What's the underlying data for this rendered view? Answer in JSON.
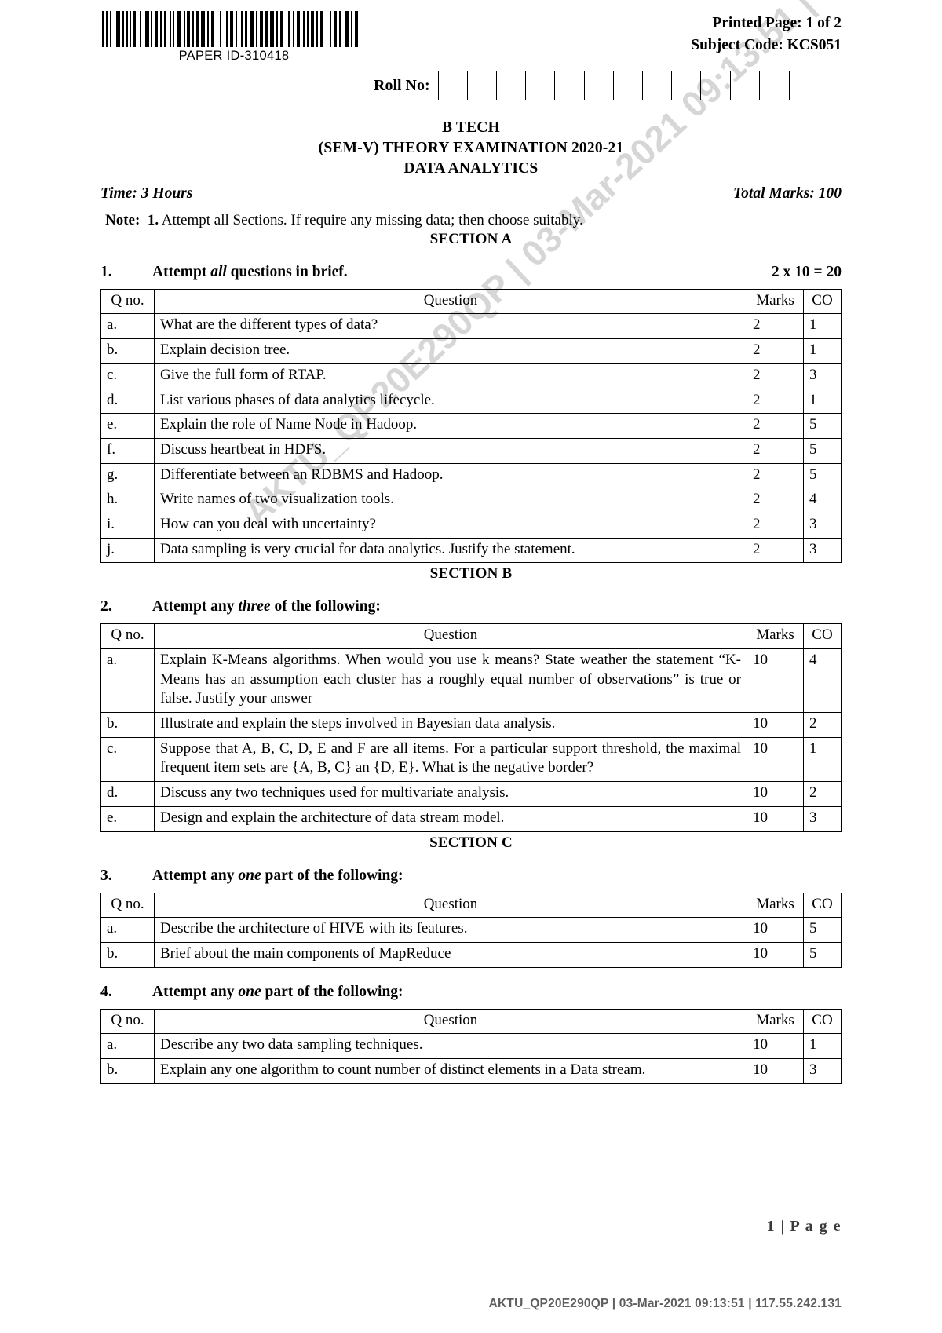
{
  "header": {
    "paper_id": "PAPER ID-310418",
    "printed_page": "Printed Page: 1 of 2",
    "subject_code": "Subject Code: KCS051",
    "roll_label": "Roll No:",
    "roll_box_count": 12
  },
  "titles": {
    "line1": "B TECH",
    "line2": "(SEM-V) THEORY EXAMINATION 2020-21",
    "line3": "DATA ANALYTICS",
    "time": "Time: 3 Hours",
    "total_marks": "Total Marks: 100",
    "note_label": "Note:",
    "note_number": "1.",
    "note_text": "Attempt all Sections. If require any missing data; then choose suitably."
  },
  "sections": {
    "a_heading": "SECTION A",
    "b_heading": "SECTION B",
    "c_heading": "SECTION C"
  },
  "columns": {
    "qno": "Q no.",
    "question": "Question",
    "marks": "Marks",
    "co": "CO"
  },
  "q1": {
    "number": "1.",
    "prompt_pre": "Attempt ",
    "prompt_em": "all",
    "prompt_post": " questions in brief.",
    "marks_formula": "2 x 10 = 20",
    "rows": [
      {
        "qno": "a.",
        "question": "What are the different types of data?",
        "marks": "2",
        "co": "1"
      },
      {
        "qno": "b.",
        "question": "Explain decision tree.",
        "marks": "2",
        "co": "1"
      },
      {
        "qno": "c.",
        "question": "Give the full form of RTAP.",
        "marks": "2",
        "co": "3"
      },
      {
        "qno": "d.",
        "question": "List various phases of data analytics lifecycle.",
        "marks": "2",
        "co": "1"
      },
      {
        "qno": "e.",
        "question": "Explain the role of Name Node in Hadoop.",
        "marks": "2",
        "co": "5"
      },
      {
        "qno": "f.",
        "question": "Discuss heartbeat in HDFS.",
        "marks": "2",
        "co": "5"
      },
      {
        "qno": "g.",
        "question": "Differentiate between an RDBMS and Hadoop.",
        "marks": "2",
        "co": "5"
      },
      {
        "qno": "h.",
        "question": "Write names of two visualization tools.",
        "marks": "2",
        "co": "4"
      },
      {
        "qno": "i.",
        "question": "How can you deal with uncertainty?",
        "marks": "2",
        "co": "3"
      },
      {
        "qno": "j.",
        "question": "Data sampling is very crucial for data analytics. Justify the statement.",
        "marks": "2",
        "co": "3"
      }
    ]
  },
  "q2": {
    "number": "2.",
    "prompt_pre": "Attempt any ",
    "prompt_em": "three",
    "prompt_post": " of the following:",
    "rows": [
      {
        "qno": "a.",
        "question": "Explain K-Means algorithms. When would you use k means? State weather the statement “K-Means has an assumption each cluster has a roughly equal number of observations” is true or false. Justify your answer",
        "marks": "10",
        "co": "4"
      },
      {
        "qno": "b.",
        "question": "Illustrate and explain the steps involved in Bayesian data analysis.",
        "marks": "10",
        "co": "2"
      },
      {
        "qno": "c.",
        "question": "Suppose that A, B, C, D, E and F are all items. For a particular support threshold, the maximal frequent item sets are {A, B, C} an {D, E}. What is the negative border?",
        "marks": "10",
        "co": "1"
      },
      {
        "qno": "d.",
        "question": "Discuss any two techniques used for multivariate analysis.",
        "marks": "10",
        "co": "2"
      },
      {
        "qno": "e.",
        "question": "Design and explain the architecture of data stream model.",
        "marks": "10",
        "co": "3"
      }
    ]
  },
  "q3": {
    "number": "3.",
    "prompt_pre": "Attempt any ",
    "prompt_em": "one",
    "prompt_post": " part of the following:",
    "rows": [
      {
        "qno": "a.",
        "question": "Describe the architecture of HIVE with its features.",
        "marks": "10",
        "co": "5"
      },
      {
        "qno": "b.",
        "question": "Brief about the main components of MapReduce",
        "marks": "10",
        "co": "5"
      }
    ]
  },
  "q4": {
    "number": "4.",
    "prompt_pre": "Attempt any ",
    "prompt_em": "one",
    "prompt_post": " part of the following:",
    "rows": [
      {
        "qno": "a.",
        "question": "Describe any two data sampling techniques.",
        "marks": "10",
        "co": "1"
      },
      {
        "qno": "b.",
        "question": "Explain any one algorithm to count number of distinct elements in a Data stream.",
        "marks": "10",
        "co": "3"
      }
    ]
  },
  "watermark": "AKTU_QP20E290QP | 03-Mar-2021 09:13:51 | 117.55.242.131",
  "footer": {
    "page_number": "1",
    "page_separator": "|",
    "page_word": "P a g e",
    "doc_footer": "AKTU_QP20E290QP | 03-Mar-2021 09:13:51 | 117.55.242.131"
  }
}
